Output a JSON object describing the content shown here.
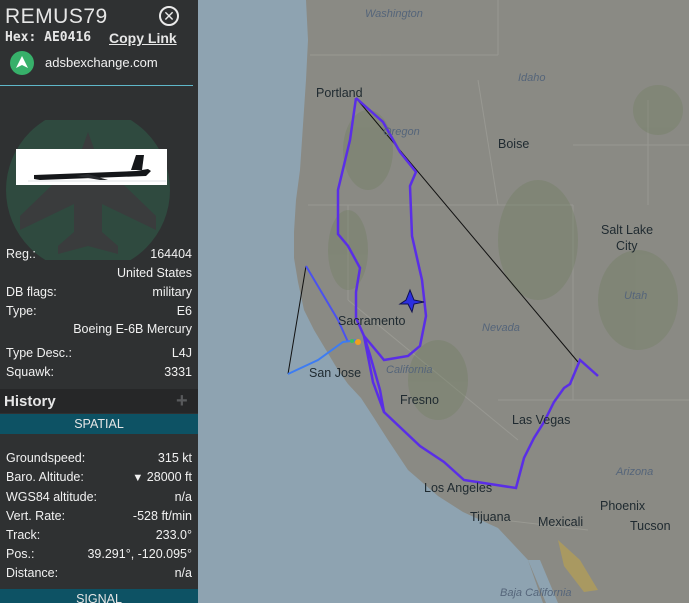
{
  "aircraft": {
    "callsign": "REMUS79",
    "hex_label": "Hex:",
    "hex": "AE0416",
    "copy_link": "Copy Link",
    "source": "adsbexchange.com"
  },
  "details": {
    "reg_label": "Reg.:",
    "reg": "164404",
    "country": "United States",
    "dbflags_label": "DB flags:",
    "dbflags": "military",
    "type_label": "Type:",
    "type": "E6",
    "type_name": "Boeing E-6B Mercury",
    "typedesc_label": "Type Desc.:",
    "typedesc": "L4J",
    "squawk_label": "Squawk:",
    "squawk": "3331"
  },
  "history": {
    "title": "History",
    "add_label": "+"
  },
  "spatial": {
    "header": "SPATIAL",
    "groundspeed_label": "Groundspeed:",
    "groundspeed": "315",
    "groundspeed_unit": "kt",
    "baro_label": "Baro. Altitude:",
    "baro_trend": "▼",
    "baro": "28000",
    "baro_unit": "ft",
    "wgs_label": "WGS84 altitude:",
    "wgs": "n/a",
    "vrate_label": "Vert. Rate:",
    "vrate": "-528",
    "vrate_unit": "ft/min",
    "track_label": "Track:",
    "track": "233.0°",
    "pos_label": "Pos.:",
    "pos": "39.291°, -120.095°",
    "distance_label": "Distance:",
    "distance": "n/a"
  },
  "signal": {
    "header": "SIGNAL"
  },
  "map": {
    "cities": {
      "portland": "Portland",
      "boise": "Boise",
      "salt_lake_1": "Salt Lake",
      "salt_lake_2": "City",
      "sacramento": "Sacramento",
      "san_jose": "San Jose",
      "fresno": "Fresno",
      "las_vegas": "Las Vegas",
      "los_angeles": "Los Angeles",
      "tijuana": "Tijuana",
      "mexicali": "Mexicali",
      "phoenix": "Phoenix",
      "tucson": "Tucson"
    },
    "states": {
      "washington": "Washington",
      "oregon": "Oregon",
      "idaho": "Idaho",
      "utah": "Utah",
      "nevada": "Nevada",
      "california": "California",
      "arizona": "Arizona",
      "baja": "Baja California"
    },
    "colors": {
      "track": "#5a2ee6",
      "track_light": "#3d7cf2",
      "gap_line": "#111111",
      "land": "#8a8a84",
      "ocean": "#8ea3b1"
    }
  }
}
